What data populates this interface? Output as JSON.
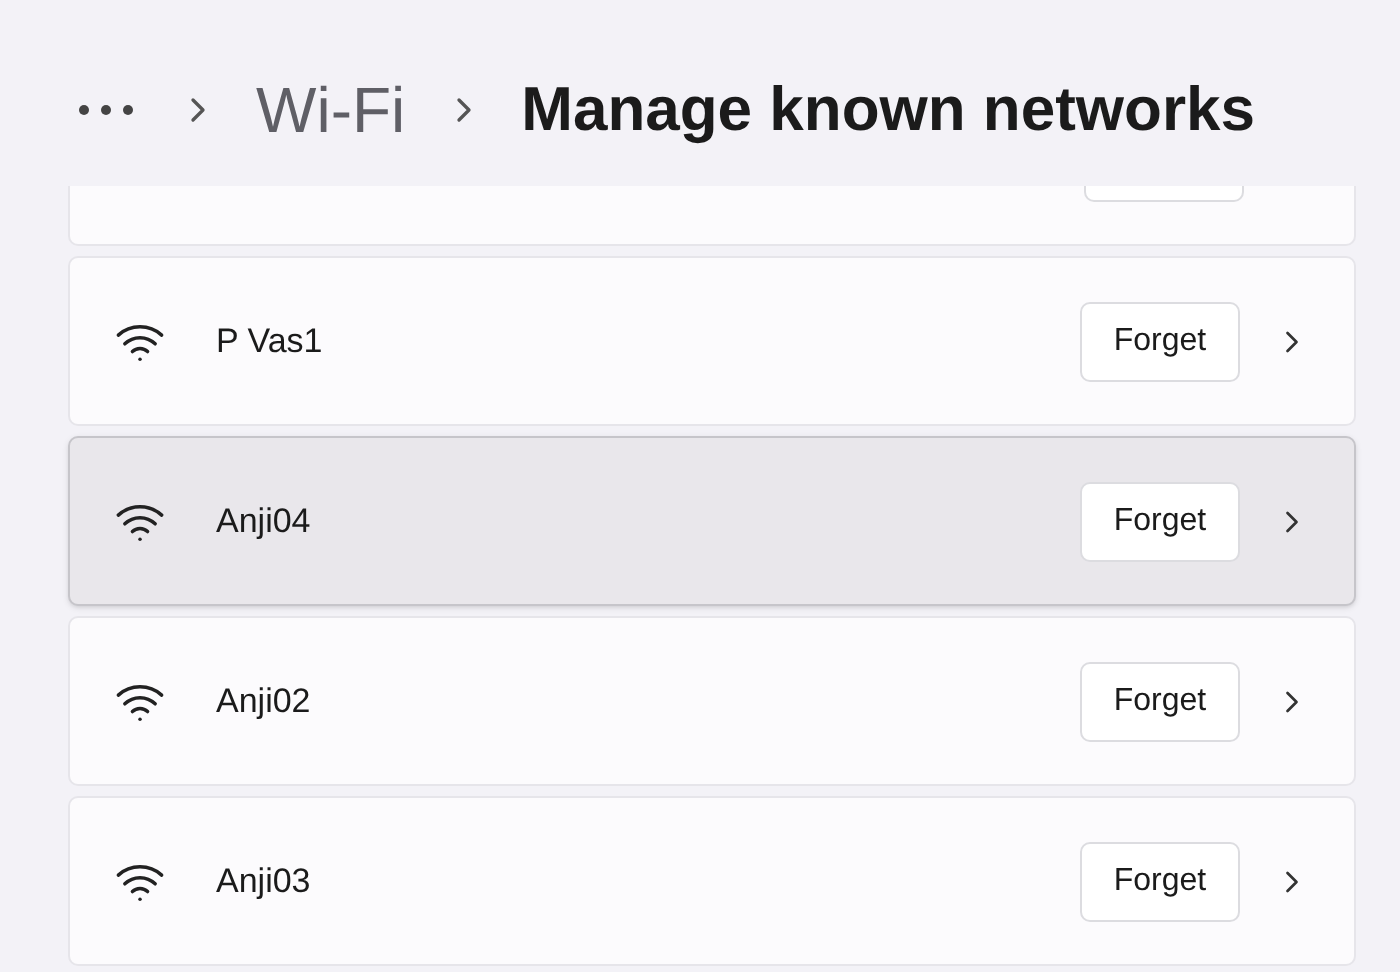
{
  "breadcrumb": [
    {
      "label": "Wi-Fi",
      "current": false
    },
    {
      "label": "Manage known networks",
      "current": true
    }
  ],
  "networks": [
    {
      "name": "P Vas1",
      "action": "Forget",
      "hovered": false
    },
    {
      "name": "Anji04",
      "action": "Forget",
      "hovered": true
    },
    {
      "name": "Anji02",
      "action": "Forget",
      "hovered": false
    },
    {
      "name": "Anji03",
      "action": "Forget",
      "hovered": false
    }
  ]
}
